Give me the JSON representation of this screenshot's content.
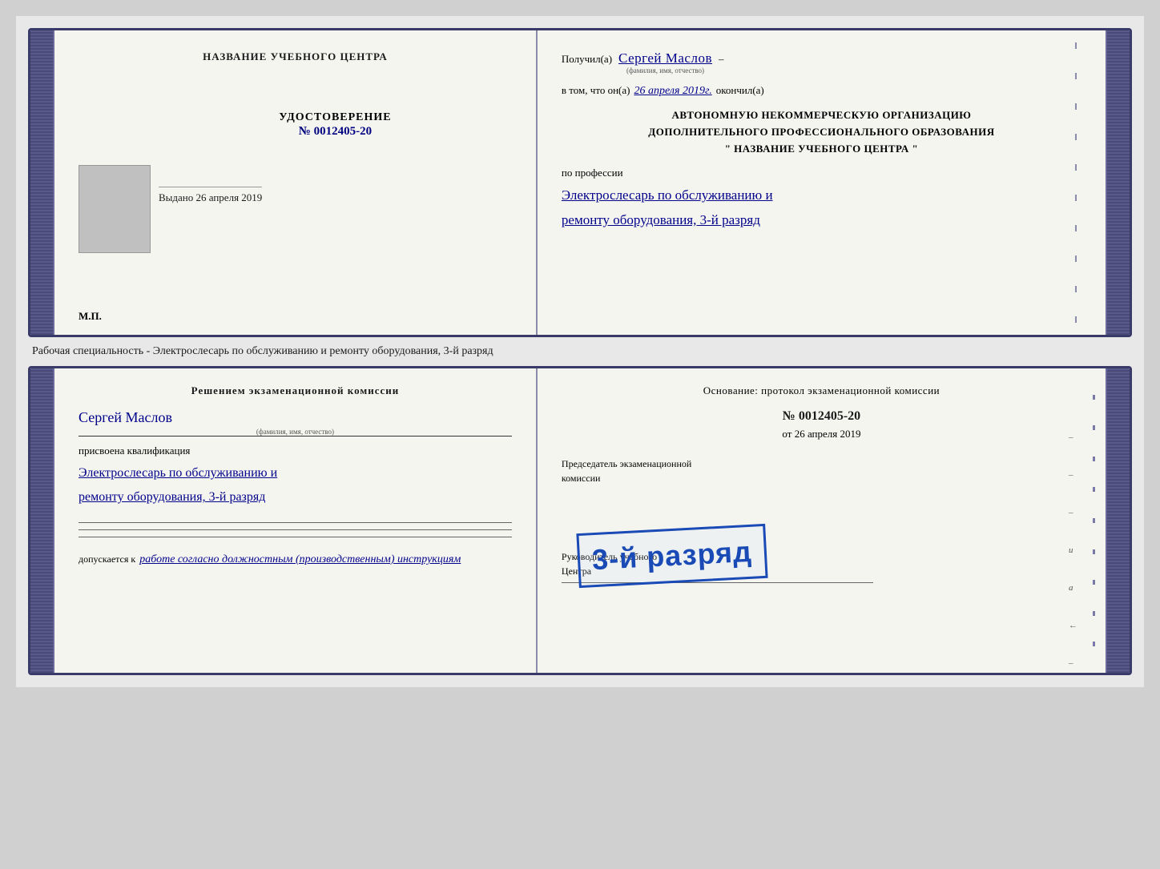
{
  "doc1": {
    "left": {
      "center_title": "НАЗВАНИЕ УЧЕБНОГО ЦЕНТРА",
      "photo_alt": "photo",
      "udostoverenie_label": "УДОСТОВЕРЕНИЕ",
      "number_prefix": "№",
      "number_value": "0012405-20",
      "vydano_label": "Выдано",
      "vydano_date": "26 апреля 2019",
      "mp": "М.П."
    },
    "right": {
      "poluchil_prefix": "Получил(а)",
      "recipient_name": "Сергей Маслов",
      "fio_label": "(фамилия, имя, отчество)",
      "dash": "–",
      "vtom_prefix": "в том, что он(а)",
      "completion_date": "26 апреля 2019г.",
      "okoncil_suffix": "окончил(а)",
      "org_line1": "АВТОНОМНУЮ НЕКОММЕРЧЕСКУЮ ОРГАНИЗАЦИЮ",
      "org_line2": "ДОПОЛНИТЕЛЬНОГО ПРОФЕССИОНАЛЬНОГО ОБРАЗОВАНИЯ",
      "org_line3": "\" НАЗВАНИЕ УЧЕБНОГО ЦЕНТРА \"",
      "po_professii_label": "по профессии",
      "profession_line1": "Электрослесарь по обслуживанию и",
      "profession_line2": "ремонту оборудования, 3-й разряд"
    }
  },
  "between": {
    "text": "Рабочая специальность - Электрослесарь по обслуживанию и ремонту оборудования, 3-й разряд"
  },
  "doc2": {
    "left": {
      "resheniem_title": "Решением экзаменационной комиссии",
      "name_handwritten": "Сергей Маслов",
      "fio_label": "(фамилия, имя, отчество)",
      "prisvoena_label": "присвоена квалификация",
      "qualification_line1": "Электрослесарь по обслуживанию и",
      "qualification_line2": "ремонту оборудования, 3-й разряд",
      "dopuskaetsya_prefix": "допускается к",
      "dopusk_text": "работе согласно должностным (производственным) инструкциям"
    },
    "right": {
      "osnovanie_text": "Основание: протокол экзаменационной комиссии",
      "number_prefix": "№",
      "number_value": "0012405-20",
      "ot_prefix": "от",
      "ot_date": "26 апреля 2019",
      "predsedatel_line1": "Председатель экзаменационной",
      "predsedatel_line2": "комиссии",
      "stamp_text": "3-й разряд",
      "rukovoditel_line1": "Руководитель учебного",
      "rukovoditel_line2": "Центра"
    }
  }
}
